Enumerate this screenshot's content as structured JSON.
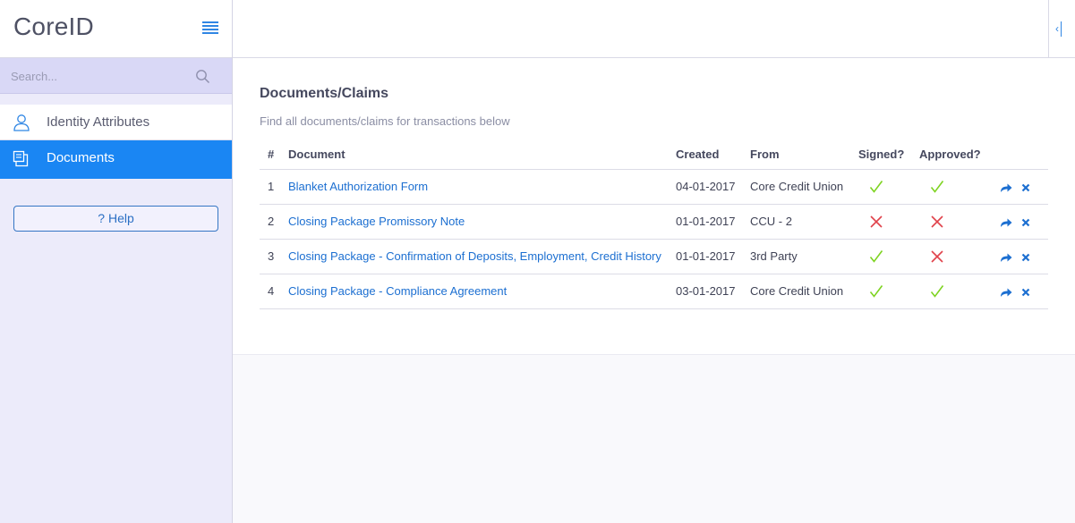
{
  "brand": {
    "name": "CoreID"
  },
  "search": {
    "placeholder": "Search..."
  },
  "nav": {
    "items": [
      {
        "label": "Identity Attributes",
        "icon": "user-icon"
      },
      {
        "label": "Documents",
        "icon": "documents-icon",
        "active": true
      }
    ]
  },
  "help": {
    "label": "Help"
  },
  "main": {
    "title": "Documents/Claims",
    "subtitle": "Find all documents/claims for transactions below",
    "columns": [
      "#",
      "Document",
      "Created",
      "From",
      "Signed?",
      "Approved?"
    ],
    "rows": [
      {
        "num": "1",
        "document": "Blanket Authorization Form",
        "created": "04-01-2017",
        "from": "Core Credit Union",
        "signed": true,
        "approved": true
      },
      {
        "num": "2",
        "document": "Closing Package Promissory Note",
        "created": "01-01-2017",
        "from": "CCU - 2",
        "signed": false,
        "approved": false
      },
      {
        "num": "3",
        "document": "Closing Package - Confirmation of Deposits, Employment, Credit History",
        "created": "01-01-2017",
        "from": "3rd Party",
        "signed": true,
        "approved": false
      },
      {
        "num": "4",
        "document": "Closing Package - Compliance Agreement",
        "created": "03-01-2017",
        "from": "Core Credit Union",
        "signed": true,
        "approved": true
      }
    ]
  },
  "colors": {
    "accent": "#1a86f3",
    "check": "#7ed321",
    "cross": "#e0424b",
    "link": "#1c6fd1"
  }
}
